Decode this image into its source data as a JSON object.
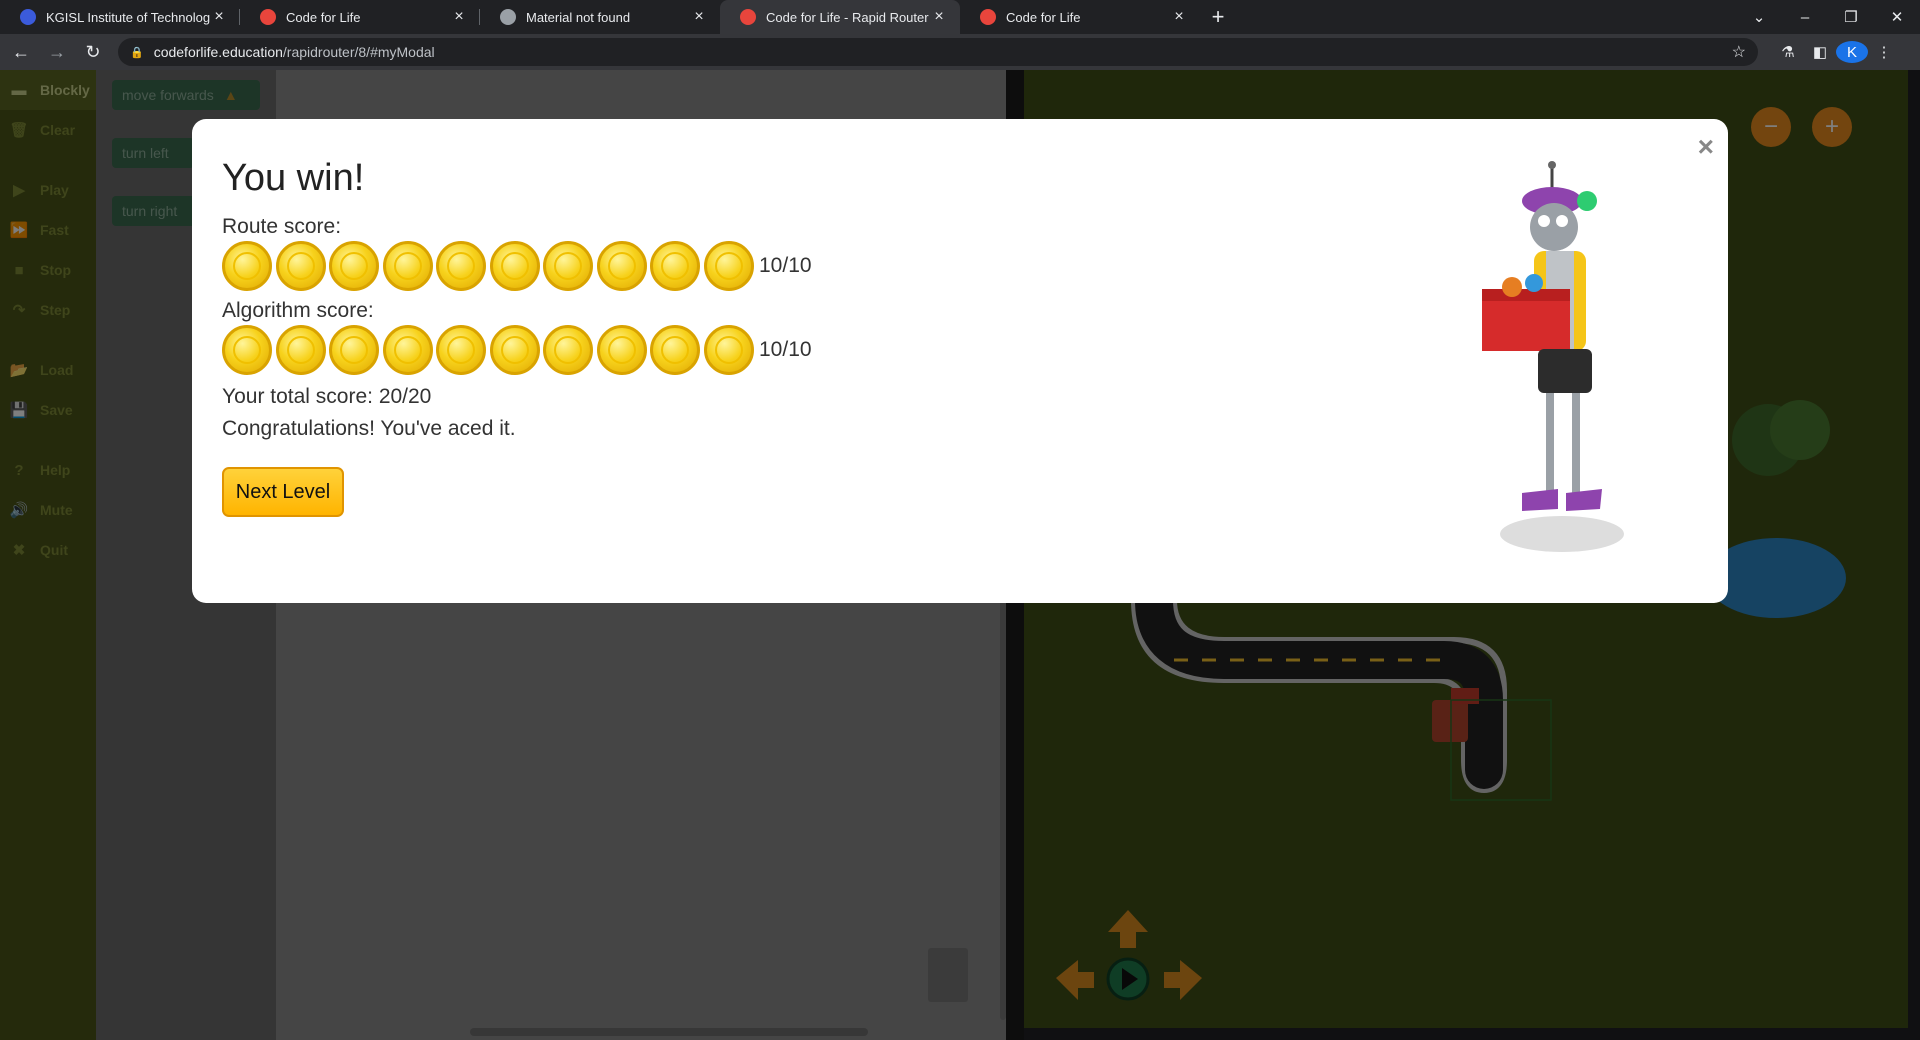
{
  "browser": {
    "tabs": [
      {
        "title": "KGISL Institute of Technology",
        "fav_color": "#3b5bdb",
        "active": false
      },
      {
        "title": "Code for Life",
        "fav_color": "#e8453c",
        "active": false
      },
      {
        "title": "Material not found",
        "fav_color": "#9aa0a6",
        "active": false
      },
      {
        "title": "Code for Life - Rapid Router",
        "fav_color": "#e8453c",
        "active": true
      },
      {
        "title": "Code for Life",
        "fav_color": "#e8453c",
        "active": false
      }
    ],
    "url_host": "codeforlife.education",
    "url_path": "/rapidrouter/8/#myModal",
    "profile_initial": "K"
  },
  "sidebar": {
    "items": [
      {
        "label": "Blockly",
        "icon": "blockly-icon"
      },
      {
        "label": "Clear",
        "icon": "trash-icon"
      },
      {
        "label": "Play",
        "icon": "play-icon"
      },
      {
        "label": "Fast",
        "icon": "fast-forward-icon"
      },
      {
        "label": "Stop",
        "icon": "stop-icon"
      },
      {
        "label": "Step",
        "icon": "step-icon"
      },
      {
        "label": "Load",
        "icon": "folder-icon"
      },
      {
        "label": "Save",
        "icon": "save-icon"
      },
      {
        "label": "Help",
        "icon": "help-icon"
      },
      {
        "label": "Mute",
        "icon": "speaker-icon"
      },
      {
        "label": "Quit",
        "icon": "close-icon"
      }
    ]
  },
  "blocks": {
    "move_forwards": "move forwards",
    "turn_left": "turn left",
    "turn_right": "turn right"
  },
  "modal": {
    "title": "You win!",
    "route_label": "Route score:",
    "route_score": "10/10",
    "route_coins": 10,
    "algorithm_label": "Algorithm score:",
    "algorithm_score": "10/10",
    "algorithm_coins": 10,
    "total": "Your total score: 20/20",
    "message": "Congratulations! You've aced it.",
    "next_button": "Next Level",
    "close_symbol": "×"
  },
  "colors": {
    "accent": "#ffb400",
    "map_grass": "#3e4e16",
    "sidebar": "#4a5418"
  }
}
